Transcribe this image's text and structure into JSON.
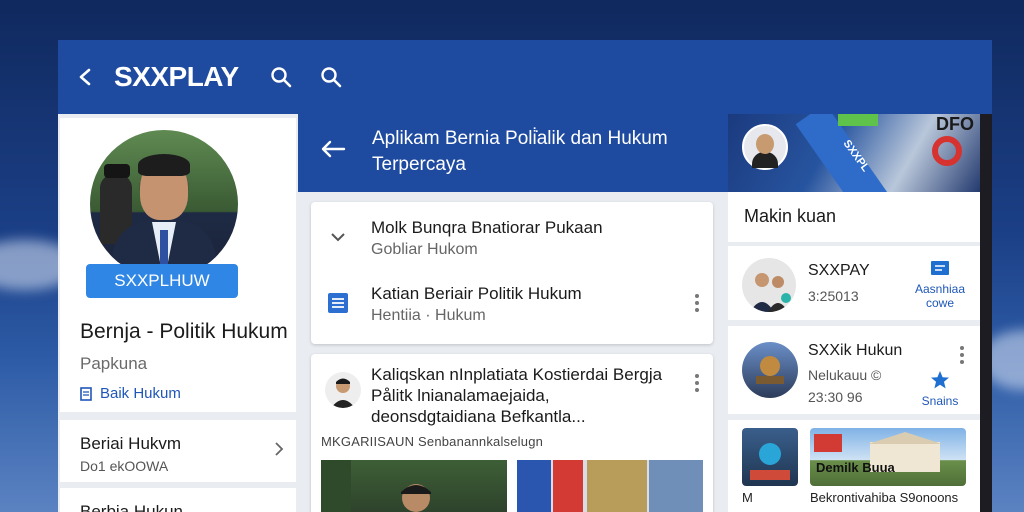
{
  "header": {
    "brand": "SXXPLAY"
  },
  "profile": {
    "name_badge": "SXXPLHUW",
    "title": "Bernja - Politik Hukum",
    "subtitle": "Papkuna",
    "link": "Baik Hukum"
  },
  "left_rows": [
    {
      "title": "Beriai Hukvm",
      "sub": "Do1 ekOOWA"
    },
    {
      "title": "Berbia Hukun",
      "sub": ""
    }
  ],
  "middle": {
    "header_title": "Aplikam Bernia Poli̇̇alik dan Hukum Terpercaya",
    "rows": [
      {
        "title": "Molk Bunqra Bnatiorar Pukaan",
        "sub": "Gobliar Hukom"
      },
      {
        "title": "Katian Beriair Politik Hukum",
        "sub": "Hentiia · Hukum"
      }
    ],
    "news": {
      "text": "Kaliqskan nInplatiata Kostierdai Bergja Pålitk lnianalamaejaida, deonsdgtaidiana Befkantla...",
      "meta": "MKGARIISAUN Senbanannkalselugn"
    }
  },
  "right": {
    "banner_brand": "DFO",
    "stripe_text": "SXXPL",
    "section_title": "Makin kuan",
    "items": [
      {
        "name": "SXXPAY",
        "time": "3:25013",
        "action": "Aasnhiaa cowe"
      },
      {
        "name": "SXXik Hukun",
        "time": "Nelukauu ©\n23:30 96",
        "action": "Snains"
      }
    ],
    "promo_caption_1": "M",
    "promo_caption_2": "Bekrontivahiba S9onoons",
    "promo_label": "Demilk Buua"
  },
  "colors": {
    "primary": "#1e4a9f",
    "accent": "#2f86e4",
    "link": "#1f57b8"
  }
}
